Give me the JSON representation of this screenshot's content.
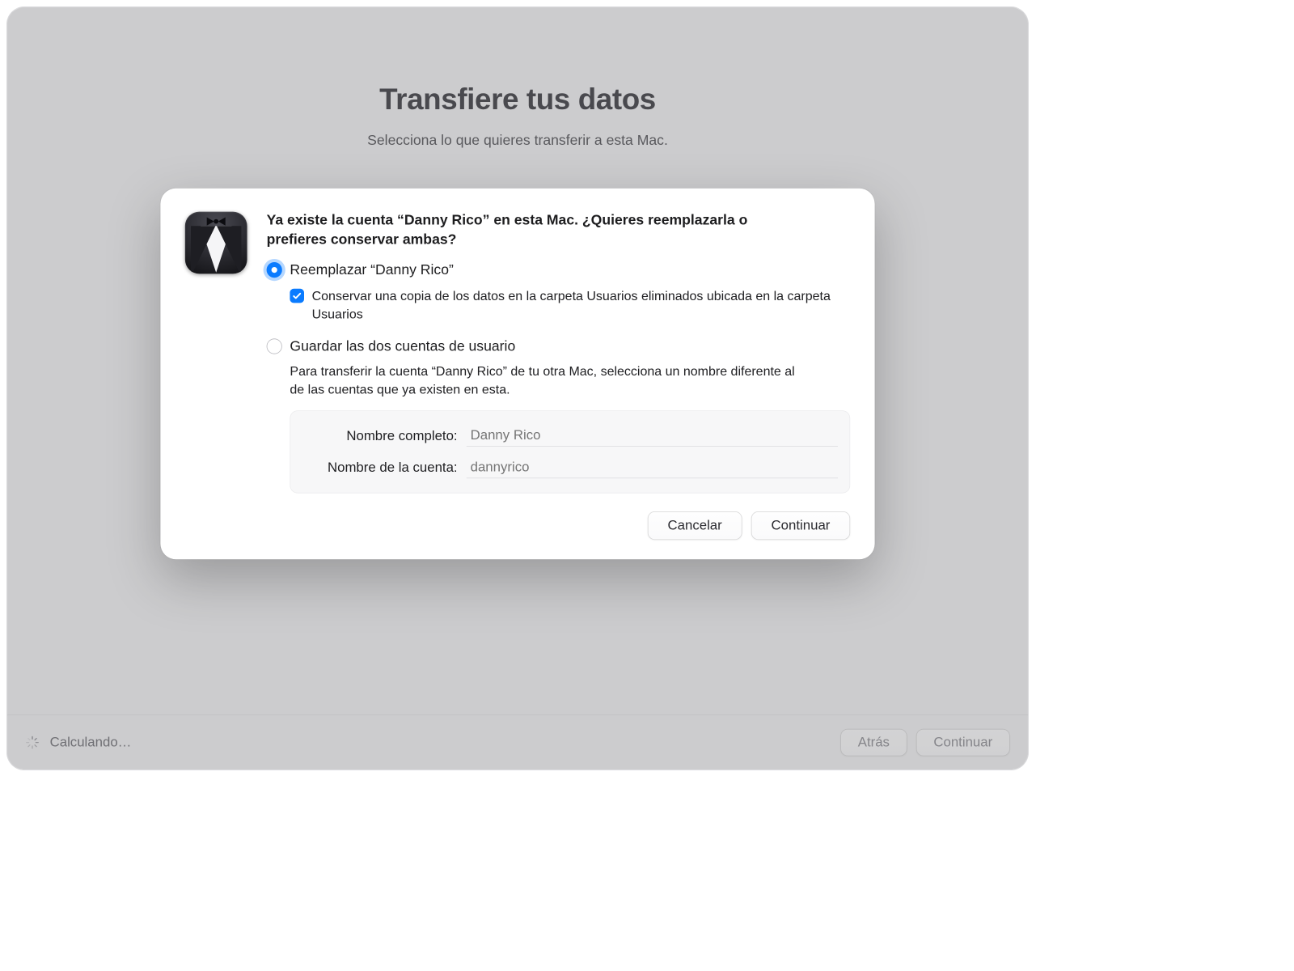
{
  "page": {
    "title": "Transfiere tus datos",
    "subtitle": "Selecciona lo que quieres transferir a esta Mac."
  },
  "dialog": {
    "heading": "Ya existe la cuenta “Danny Rico” en esta Mac. ¿Quieres reemplazarla o prefieres conservar ambas?",
    "options": {
      "replace": {
        "label": "Reemplazar “Danny Rico”",
        "selected": true,
        "keep_copy": {
          "checked": true,
          "label": "Conservar una copia de los datos en la carpeta Usuarios eliminados ubicada en la carpeta Usuarios"
        }
      },
      "keep_both": {
        "label": "Guardar las dos cuentas de usuario",
        "selected": false,
        "description": "Para transferir la cuenta “Danny Rico” de tu otra Mac, selecciona un nombre diferente al de las cuentas que ya existen en esta.",
        "fields": {
          "full_name_label": "Nombre completo:",
          "full_name_placeholder": "Danny Rico",
          "account_name_label": "Nombre de la cuenta:",
          "account_name_placeholder": "dannyrico"
        }
      }
    },
    "buttons": {
      "cancel": "Cancelar",
      "continue": "Continuar"
    }
  },
  "footer": {
    "status": "Calculando…",
    "back": "Atrás",
    "continue": "Continuar"
  }
}
